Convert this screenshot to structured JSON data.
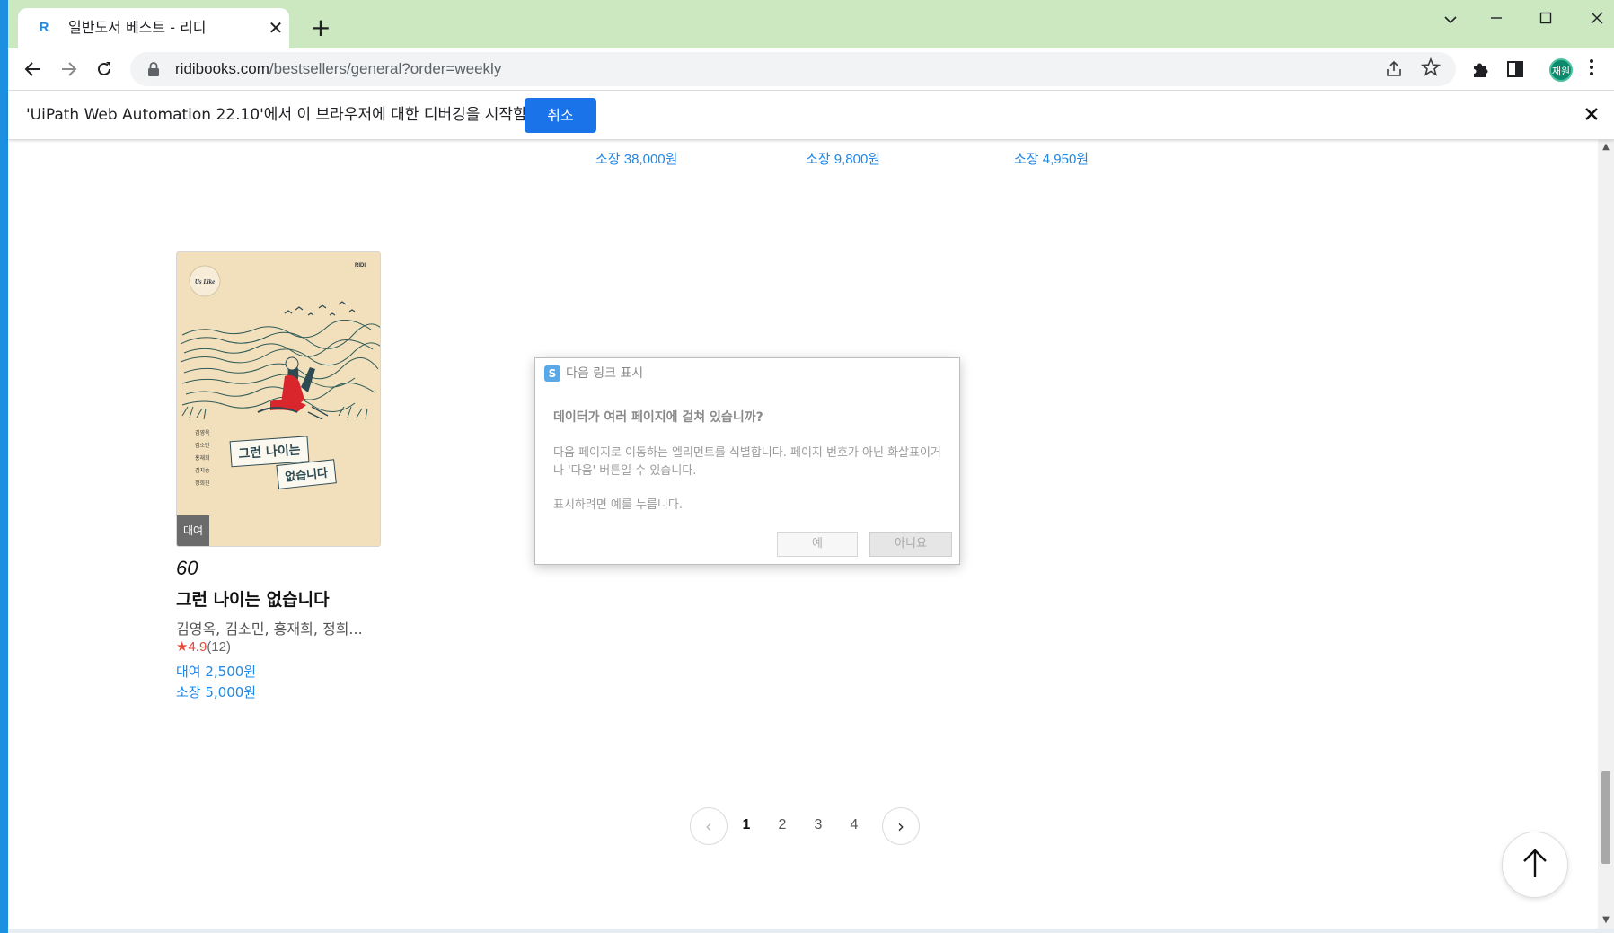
{
  "tab": {
    "favicon": "R",
    "title": "일반도서 베스트 - 리디",
    "close": "✕"
  },
  "newtab": "+",
  "window": {
    "chevron": "⌄",
    "minimize": "—",
    "maximize": "☐",
    "close": "✕"
  },
  "omnibox": {
    "domain": "ridibooks.com",
    "path": "/bestsellers/general?order=weekly"
  },
  "profile": {
    "initials": "재원"
  },
  "debugbar": {
    "message": "'UiPath Web Automation 22.10'에서 이 브라우저에 대한 디버깅을 시작함",
    "cancel_label": "취소"
  },
  "prev_row": {
    "prices": [
      "소장 38,000원",
      "소장 9,800원",
      "소장 4,950원"
    ]
  },
  "book": {
    "rent_badge": "대여",
    "rank": "60",
    "title": "그런 나이는 없습니다",
    "authors": "김영옥, 김소민, 홍재희, 정희...",
    "star": "★",
    "rating": "4.9",
    "rating_count": "(12)",
    "rent_price": "대여 2,500원",
    "own_price": "소장 5,000원",
    "cover": {
      "series": "Us Like",
      "publisher": "RIDI",
      "title_line1": "그런 나이는",
      "title_line2": "없습니다",
      "authors_vertical": [
        "김영옥",
        "김소민",
        "홍재희",
        "김지승",
        "정희진"
      ]
    }
  },
  "pagination": {
    "prev": "‹",
    "next": "›",
    "pages": [
      "1",
      "2",
      "3",
      "4"
    ],
    "active": "1"
  },
  "dialog": {
    "title": "다음 링크 표시",
    "question": "데이터가 여러 페이지에 걸쳐 있습니까?",
    "body": "다음 페이지로 이동하는 엘리먼트를 식별합니다. 페이지 번호가 아닌 화살표이거나 '다음' 버튼일 수 있습니다.",
    "prompt": "표시하려면 예를 누릅니다.",
    "yes_label": "예",
    "no_label": "아니요"
  },
  "colors": {
    "accent": "#1a73e8",
    "link_blue": "#1f87e5",
    "rating_red": "#e64938",
    "tab_bar": "#cbe8c1"
  }
}
